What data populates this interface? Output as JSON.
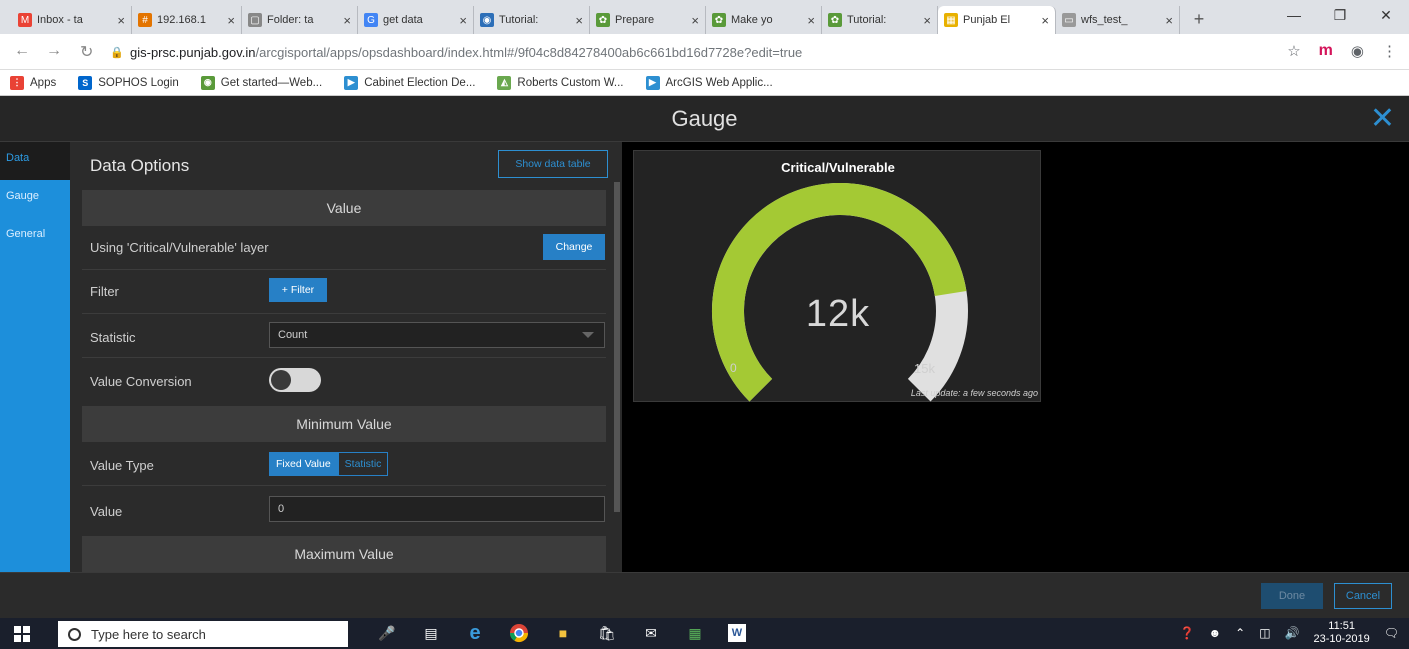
{
  "browser": {
    "tabs": [
      {
        "title": "Inbox - ta",
        "active": false,
        "icon": "gmail-icon"
      },
      {
        "title": "192.168.1",
        "active": false,
        "icon": "server-icon"
      },
      {
        "title": "Folder: ta",
        "active": false,
        "icon": "folder-icon"
      },
      {
        "title": "get data",
        "active": false,
        "icon": "google-icon"
      },
      {
        "title": "Tutorial:",
        "active": false,
        "icon": "tutorial-icon"
      },
      {
        "title": "Prepare",
        "active": false,
        "icon": "esri-icon"
      },
      {
        "title": "Make yo",
        "active": false,
        "icon": "esri-icon"
      },
      {
        "title": "Tutorial:",
        "active": false,
        "icon": "esri-icon"
      },
      {
        "title": "Punjab El",
        "active": true,
        "icon": "dashboard-icon"
      },
      {
        "title": "wfs_test_",
        "active": false,
        "icon": "page-icon"
      }
    ],
    "url_host": "gis-prsc.punjab.gov.in",
    "url_path": "/arcgisportal/apps/opsdashboard/index.html#/9f04c8d84278400ab6c661bd16d7728e?edit=true",
    "bookmarks": [
      {
        "label": "Apps",
        "icon": "apps-grid-icon"
      },
      {
        "label": "SOPHOS Login",
        "icon": "sophos-icon"
      },
      {
        "label": "Get started—Web...",
        "icon": "esri-globe-icon"
      },
      {
        "label": "Cabinet Election De...",
        "icon": "webapp-icon"
      },
      {
        "label": "Roberts Custom W...",
        "icon": "custom-map-icon"
      },
      {
        "label": "ArcGIS Web Applic...",
        "icon": "webapp-icon"
      }
    ]
  },
  "app": {
    "title": "Gauge",
    "left_tabs": [
      "Data",
      "Gauge",
      "General"
    ],
    "active_tab": "Data"
  },
  "panel": {
    "heading": "Data Options",
    "show_data_table": "Show data table",
    "value_section": "Value",
    "layer_text": "Using 'Critical/Vulnerable' layer",
    "change_label": "Change",
    "filter_label": "Filter",
    "filter_button": "+ Filter",
    "statistic_label": "Statistic",
    "statistic_value": "Count",
    "value_conversion_label": "Value Conversion",
    "value_conversion_on": false,
    "min_section": "Minimum Value",
    "value_type_label": "Value Type",
    "value_type_options": [
      "Fixed Value",
      "Statistic"
    ],
    "value_type_selected": "Fixed Value",
    "value_label": "Value",
    "value_input": "0",
    "max_section": "Maximum Value"
  },
  "gauge": {
    "title": "Critical/Vulnerable",
    "display_value": "12k",
    "min_label": "0",
    "max_label": "15k",
    "fill_fraction": 0.8,
    "fill_color": "#a4c934",
    "track_color": "#e0e0e0",
    "last_update": "Last update: a few seconds ago"
  },
  "footer": {
    "done": "Done",
    "cancel": "Cancel"
  },
  "taskbar": {
    "search_placeholder": "Type here to search",
    "time": "11:51",
    "date": "23-10-2019"
  }
}
